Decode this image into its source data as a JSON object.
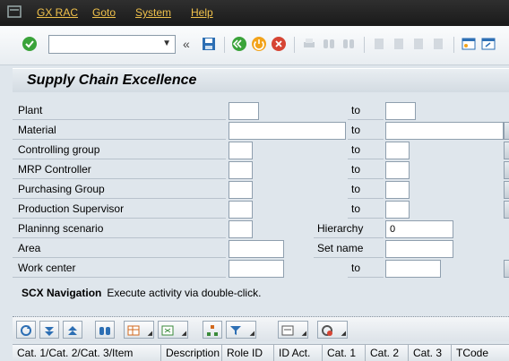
{
  "menu": {
    "items": [
      "GX RAC",
      "Goto",
      "System",
      "Help"
    ]
  },
  "toolbar": {
    "command_field_value": "",
    "icons": [
      "enter-icon",
      "command-field",
      "collapse-icon",
      "save-icon",
      "back-icon",
      "exit-icon",
      "cancel-icon",
      "print-icon",
      "find-icon",
      "find-next-icon",
      "first-page-icon",
      "previous-page-icon",
      "next-page-icon",
      "last-page-icon",
      "create-session-icon",
      "shortcut-icon"
    ]
  },
  "title": "Supply Chain Excellence",
  "fields": [
    {
      "label": "Plant",
      "to": "to",
      "from_value": "",
      "to_value": ""
    },
    {
      "label": "Material",
      "to": "to",
      "from_value": "",
      "to_value": ""
    },
    {
      "label": "Controlling group",
      "to": "to",
      "from_value": "",
      "to_value": ""
    },
    {
      "label": "MRP Controller",
      "to": "to",
      "from_value": "",
      "to_value": ""
    },
    {
      "label": "Purchasing Group",
      "to": "to",
      "from_value": "",
      "to_value": ""
    },
    {
      "label": "Production Supervisor",
      "to": "to",
      "from_value": "",
      "to_value": ""
    },
    {
      "label": "Planinng scenario",
      "from_value": "",
      "right_label": "Hierarchy",
      "right_value": "0"
    },
    {
      "label": "Area",
      "from_value": "",
      "right_label": "Set name",
      "right_value": ""
    },
    {
      "label": "Work center",
      "to": "to",
      "from_value": "",
      "to_value": ""
    }
  ],
  "navigation": {
    "title": "SCX Navigation",
    "hint": "Execute activity via double-click."
  },
  "grid": {
    "columns": [
      "Cat. 1/Cat. 2/Cat. 3/Item",
      "Description",
      "Role ID",
      "ID Act.",
      "Cat. 1",
      "Cat. 2",
      "Cat. 3",
      "TCode"
    ]
  },
  "colors": {
    "menu_text": "#f0c14b",
    "menubar_bg": "#1f1f1f",
    "screen_bg": "#dfe6ec"
  }
}
